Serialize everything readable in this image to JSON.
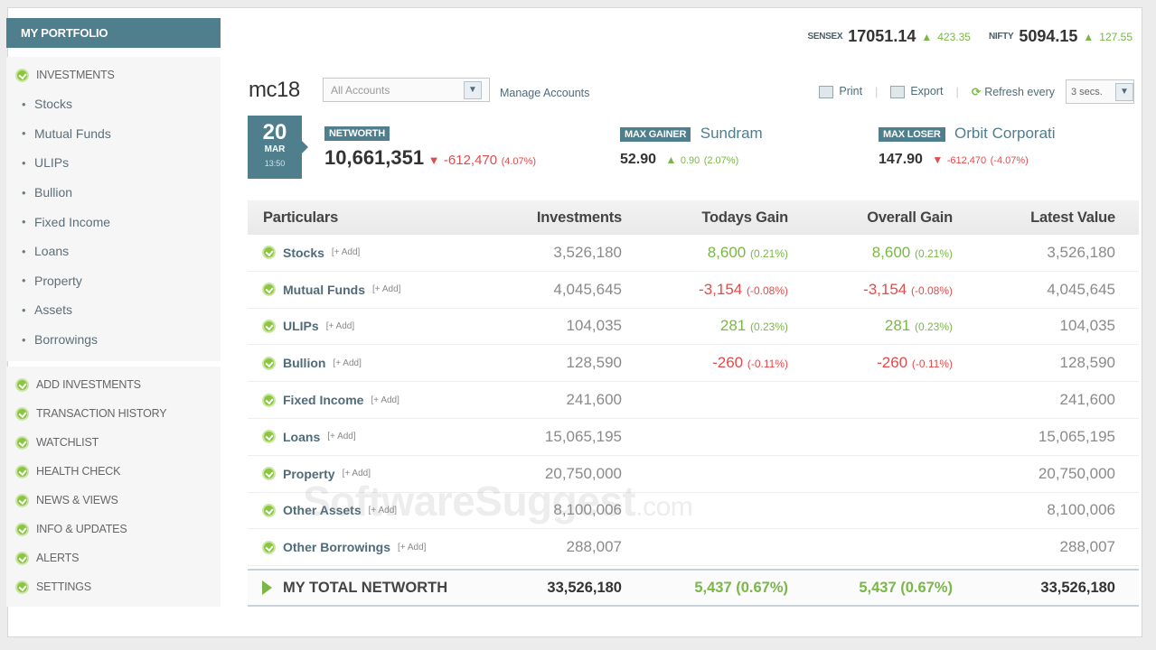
{
  "sidebar": {
    "title": "MY PORTFOLIO",
    "investments_label": "INVESTMENTS",
    "sub_items": [
      "Stocks",
      "Mutual Funds",
      "ULIPs",
      "Bullion",
      "Fixed Income",
      "Loans",
      "Property",
      "Assets",
      "Borrowings"
    ],
    "main_items": [
      "ADD INVESTMENTS",
      "TRANSACTION HISTORY",
      "WATCHLIST",
      "HEALTH CHECK",
      "NEWS & VIEWS",
      "INFO & UPDATES",
      "ALERTS",
      "SETTINGS"
    ]
  },
  "ticker": {
    "sensex_label": "SENSEX",
    "sensex_value": "17051.14",
    "sensex_change": "423.35",
    "nifty_label": "NIFTY",
    "nifty_value": "5094.15",
    "nifty_change": "127.55"
  },
  "account": {
    "name": "mc18",
    "select_value": "All Accounts",
    "manage_link": "Manage Accounts"
  },
  "toolbar": {
    "print_label": "Print",
    "export_label": "Export",
    "refresh_label": "Refresh every",
    "refresh_value": "3 secs."
  },
  "date": {
    "day": "20",
    "month": "MAR",
    "time": "13:50"
  },
  "summary": {
    "networth_label": "NETWORTH",
    "networth_value": "10,661,351",
    "networth_change": "-612,470",
    "networth_pct": "(4.07%)",
    "gainer_label": "MAX GAINER",
    "gainer_name": "Sundram",
    "gainer_value": "52.90",
    "gainer_change": "0.90",
    "gainer_pct": "(2.07%)",
    "loser_label": "MAX LOSER",
    "loser_name": "Orbit Corporati",
    "loser_value": "147.90",
    "loser_change": "-612,470",
    "loser_pct": "(-4.07%)"
  },
  "table": {
    "headers": [
      "Particulars",
      "Investments",
      "Todays Gain",
      "Overall Gain",
      "Latest Value"
    ],
    "add_label": "[+ Add]",
    "rows": [
      {
        "name": "Stocks",
        "investment": "3,526,180",
        "today": "8,600",
        "today_pct": "(0.21%)",
        "today_dir": "pos",
        "overall": "8,600",
        "overall_pct": "(0.21%)",
        "overall_dir": "pos",
        "latest": "3,526,180"
      },
      {
        "name": "Mutual Funds",
        "investment": "4,045,645",
        "today": "-3,154",
        "today_pct": "(-0.08%)",
        "today_dir": "neg",
        "overall": "-3,154",
        "overall_pct": "(-0.08%)",
        "overall_dir": "neg",
        "latest": "4,045,645"
      },
      {
        "name": "ULIPs",
        "investment": "104,035",
        "today": "281",
        "today_pct": "(0.23%)",
        "today_dir": "pos",
        "overall": "281",
        "overall_pct": "(0.23%)",
        "overall_dir": "pos",
        "latest": "104,035"
      },
      {
        "name": "Bullion",
        "investment": "128,590",
        "today": "-260",
        "today_pct": "(-0.11%)",
        "today_dir": "neg",
        "overall": "-260",
        "overall_pct": "(-0.11%)",
        "overall_dir": "neg",
        "latest": "128,590"
      },
      {
        "name": "Fixed Income",
        "investment": "241,600",
        "today": "",
        "today_pct": "",
        "today_dir": "pos",
        "overall": "",
        "overall_pct": "",
        "overall_dir": "pos",
        "latest": "241,600"
      },
      {
        "name": "Loans",
        "investment": "15,065,195",
        "today": "",
        "today_pct": "",
        "today_dir": "pos",
        "overall": "",
        "overall_pct": "",
        "overall_dir": "pos",
        "latest": "15,065,195"
      },
      {
        "name": "Property",
        "investment": "20,750,000",
        "today": "",
        "today_pct": "",
        "today_dir": "pos",
        "overall": "",
        "overall_pct": "",
        "overall_dir": "pos",
        "latest": "20,750,000"
      },
      {
        "name": "Other Assets",
        "investment": "8,100,006",
        "today": "",
        "today_pct": "",
        "today_dir": "pos",
        "overall": "",
        "overall_pct": "",
        "overall_dir": "pos",
        "latest": "8,100,006"
      },
      {
        "name": "Other Borrowings",
        "investment": "288,007",
        "today": "",
        "today_pct": "",
        "today_dir": "pos",
        "overall": "",
        "overall_pct": "",
        "overall_dir": "pos",
        "latest": "288,007"
      }
    ],
    "total": {
      "label": "MY TOTAL NETWORTH",
      "investment": "33,526,180",
      "today": "5,437 (0.67%)",
      "overall": "5,437 (0.67%)",
      "latest": "33,526,180"
    }
  },
  "watermark": {
    "main": "SoftwareSuggest",
    "suffix": ".com"
  },
  "colors": {
    "accent": "#4f7e8d",
    "positive": "#7ab648",
    "negative": "#e24b4b"
  }
}
